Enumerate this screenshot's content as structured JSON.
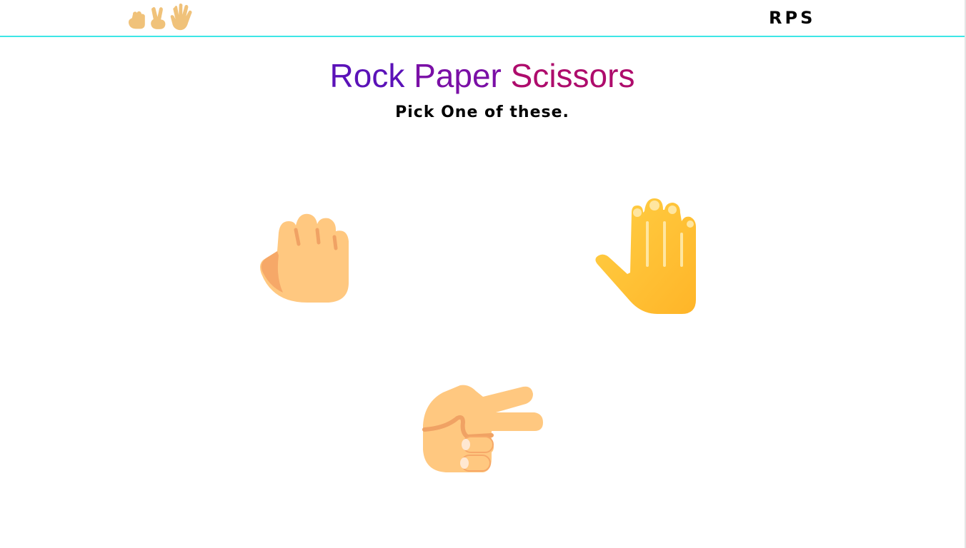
{
  "nav": {
    "logo_icons": [
      "rock-hand-icon",
      "scissors-hand-icon",
      "paper-hand-icon"
    ],
    "brand": "RPS"
  },
  "header": {
    "title": "Rock Paper Scissors",
    "title_words": [
      "Rock",
      "Paper",
      "Scissors"
    ],
    "title_colors": [
      "#5b12b8",
      "#7a0fa6",
      "#ae0c6c"
    ],
    "subtitle": "Pick One of these."
  },
  "choices": [
    {
      "name": "rock",
      "icon": "rock-hand-icon",
      "color": "#ffc880"
    },
    {
      "name": "paper",
      "icon": "paper-hand-icon",
      "color": "#ffc22e"
    },
    {
      "name": "scissors",
      "icon": "scissors-hand-icon",
      "color": "#ffc880"
    }
  ],
  "colors": {
    "nav_border": "#3de6e6",
    "skin": "#ffc880",
    "skin_shadow": "#f0a264",
    "paper_yellow": "#ffc22e"
  }
}
